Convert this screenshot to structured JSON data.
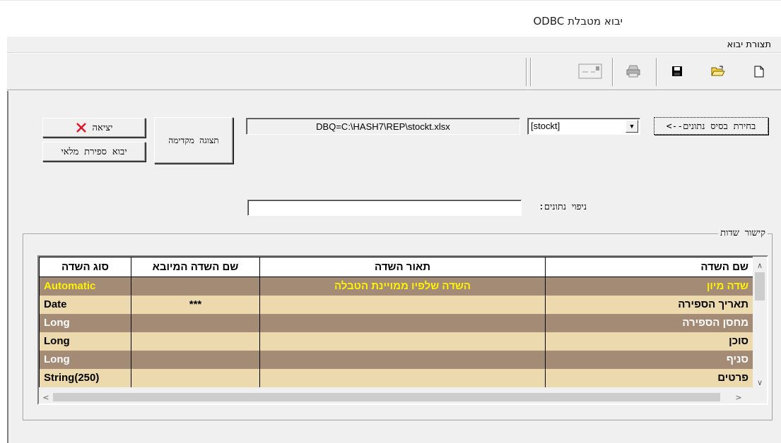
{
  "window": {
    "title": "יבוא מטבלת ODBC"
  },
  "menu": {
    "item": "תצורת יבוא"
  },
  "toolbar": {
    "icons": [
      "window-icon",
      "print-icon",
      "save-icon",
      "open-folder-icon",
      "new-document-icon"
    ]
  },
  "controls": {
    "select_source_button": "בחירת בסיס נתונים-->",
    "table_combo_value": "[stockt]",
    "connection_string": "DBQ=C:\\HASH7\\REP\\stockt.xlsx",
    "preview_button": "תצוגה מקדימה",
    "exit_button": "יציאה",
    "import_full_count_button": "יבוא ספירת מלאי",
    "filter_label": "ניפוי נתונים:",
    "filter_value": ""
  },
  "mapping": {
    "legend": "קישור שדות",
    "columns": [
      "שם השדה",
      "תאור השדה",
      "שם השדה המיובא",
      "סוג השדה"
    ],
    "rows": [
      {
        "field": "שדה מיון",
        "description": "השדה שלפיו ממויינת הטבלה",
        "imported": "",
        "type": "Automatic"
      },
      {
        "field": "תאריך הספירה",
        "description": "",
        "imported": "***",
        "type": "Date"
      },
      {
        "field": "מחסן הספירה",
        "description": "",
        "imported": "",
        "type": "Long"
      },
      {
        "field": "סוכן",
        "description": "",
        "imported": "",
        "type": "Long"
      },
      {
        "field": "סניף",
        "description": "",
        "imported": "",
        "type": "Long"
      },
      {
        "field": "פרטים",
        "description": "",
        "imported": "",
        "type": "String(250)"
      }
    ]
  },
  "colors": {
    "row_dark": "#a48b76",
    "row_light": "#ecd9ad",
    "highlight_text": "#fff200",
    "exit_x": "#e0142a"
  }
}
